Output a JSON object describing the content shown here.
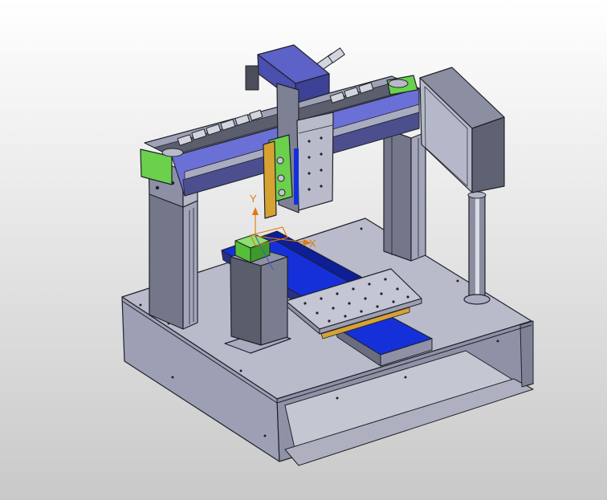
{
  "viewport": {
    "background_top": "#ffffff",
    "background_bottom": "#c9c9c9"
  },
  "colors": {
    "steel": "#a9acc0",
    "steel_dark": "#6b6e7e",
    "steel_light": "#c8cad8",
    "edge": "#20222a",
    "accent_blue": "#1530d8",
    "carriage_blue": "#6b70d6",
    "bracket_green": "#6bd04c",
    "bracket_gold": "#d6a232",
    "axis_orange": "#e07a10"
  },
  "triad": {
    "y_label": "Y",
    "x_label": "X"
  }
}
